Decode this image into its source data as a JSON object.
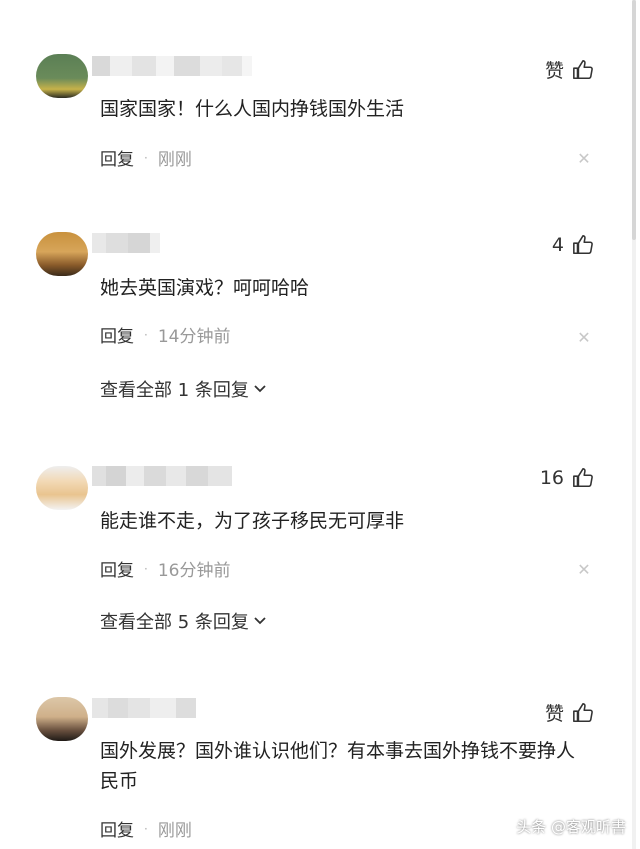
{
  "comments": [
    {
      "like_label": "赞",
      "text": "国家国家！什么人国内挣钱国外生活",
      "reply_label": "回复",
      "separator": "·",
      "time": "刚刚"
    },
    {
      "like_label": "4",
      "text": "她去英国演戏？呵呵哈哈",
      "reply_label": "回复",
      "separator": "·",
      "time": "14分钟前",
      "view_replies": "查看全部 1 条回复"
    },
    {
      "like_label": "16",
      "text": "能走谁不走，为了孩子移民无可厚非",
      "reply_label": "回复",
      "separator": "·",
      "time": "16分钟前",
      "view_replies": "查看全部 5 条回复"
    },
    {
      "like_label": "赞",
      "text": "国外发展？国外谁认识他们？有本事去国外挣钱不要挣人民币",
      "reply_label": "回复",
      "separator": "·",
      "time": "刚刚"
    }
  ],
  "icons": {
    "like": "thumbs-up-icon",
    "close": "close-icon",
    "expand": "chevron-down-icon"
  },
  "watermark": "头条 @客观听書",
  "colors": {
    "text": "#222222",
    "meta": "#999999",
    "background": "#ffffff"
  }
}
